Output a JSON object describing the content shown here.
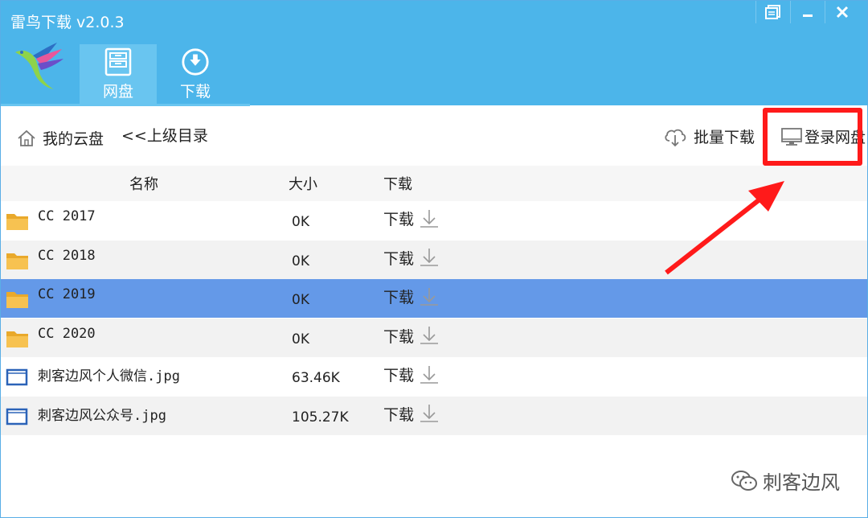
{
  "window": {
    "title": "雷鸟下载 v2.0.3",
    "controls": [
      "restore",
      "minimize",
      "close"
    ]
  },
  "nav": {
    "tabs": [
      {
        "label": "网盘",
        "icon": "cabinet-icon",
        "active": true
      },
      {
        "label": "下载",
        "icon": "download-circle-icon",
        "active": false
      }
    ]
  },
  "toolbar": {
    "home_label": "我的云盘",
    "up_label": "<<上级目录",
    "batch_download_label": "批量下载",
    "login_label": "登录网盘"
  },
  "table": {
    "columns": {
      "name": "名称",
      "size": "大小",
      "download": "下载"
    },
    "rows": [
      {
        "name": "CC 2017",
        "size": "0K",
        "download": "下载",
        "type": "folder",
        "selected": false
      },
      {
        "name": "CC 2018",
        "size": "0K",
        "download": "下载",
        "type": "folder",
        "selected": false
      },
      {
        "name": "CC 2019",
        "size": "0K",
        "download": "下载",
        "type": "folder",
        "selected": true
      },
      {
        "name": "CC 2020",
        "size": "0K",
        "download": "下载",
        "type": "folder",
        "selected": false
      },
      {
        "name": "刺客边风个人微信.jpg",
        "size": "63.46K",
        "download": "下载",
        "type": "file",
        "selected": false
      },
      {
        "name": "刺客边风公众号.jpg",
        "size": "105.27K",
        "download": "下载",
        "type": "file",
        "selected": false
      }
    ]
  },
  "watermark": {
    "text": "刺客边风"
  },
  "colors": {
    "titlebar": "#4cb5ea",
    "active_tab": "#69c5f0",
    "selected_row": "#6499e8",
    "annotation": "#ff1a1a",
    "folder": "#f5b83a"
  }
}
